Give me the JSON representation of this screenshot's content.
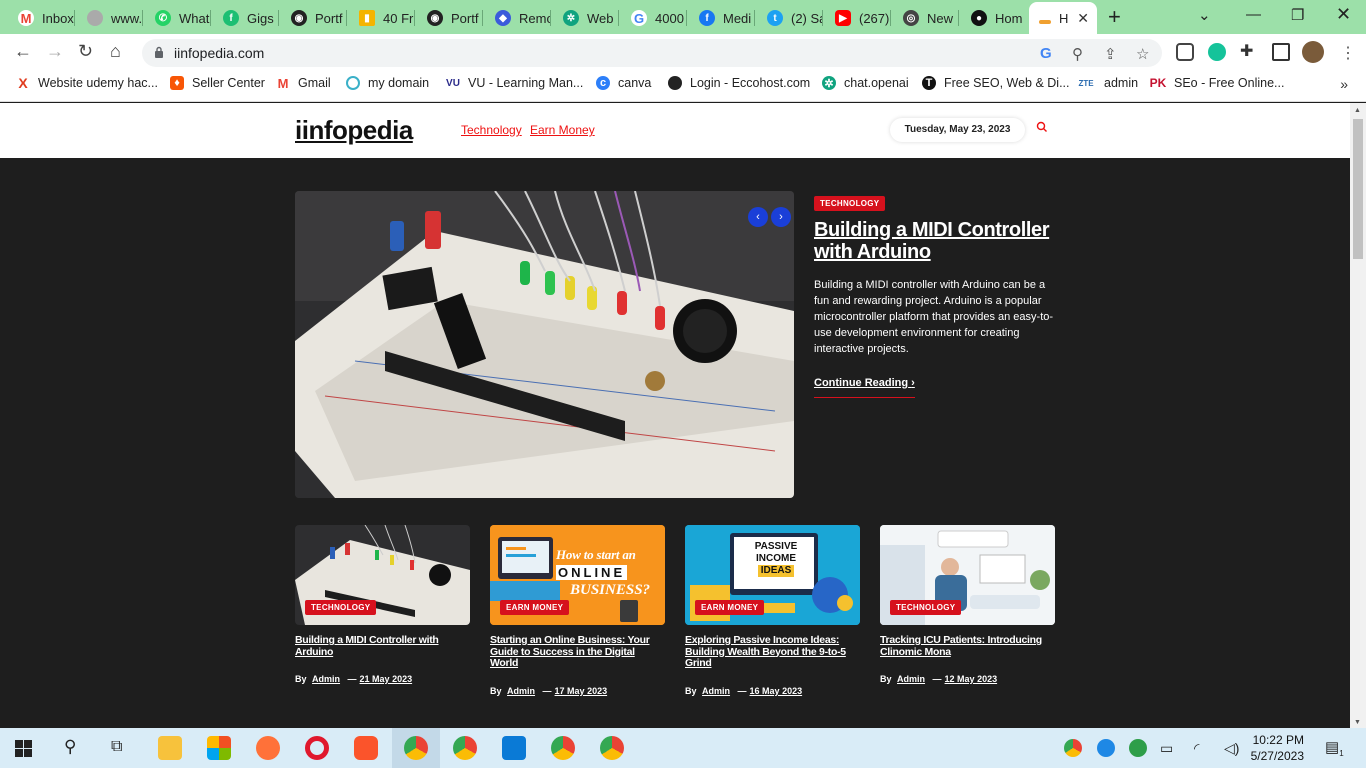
{
  "browser": {
    "tabs": [
      {
        "label": "Inbox",
        "icon": "gmail-icon",
        "color": "#ea4335"
      },
      {
        "label": "www.",
        "icon": "globe-icon",
        "color": "#888888"
      },
      {
        "label": "What",
        "icon": "whatsapp-icon",
        "color": "#25d366"
      },
      {
        "label": "Gigs",
        "icon": "fiverr-icon",
        "color": "#1dbf73"
      },
      {
        "label": "Portf",
        "icon": "site-icon",
        "color": "#222222"
      },
      {
        "label": "40 Fr",
        "icon": "chart-icon",
        "color": "#f4b400"
      },
      {
        "label": "Portf",
        "icon": "site-icon",
        "color": "#222222"
      },
      {
        "label": "Remo",
        "icon": "remote-icon",
        "color": "#3b5bdb"
      },
      {
        "label": "Web",
        "icon": "openai-icon",
        "color": "#10a37f"
      },
      {
        "label": "4000",
        "icon": "google-icon",
        "color": "#4285f4"
      },
      {
        "label": "Medi",
        "icon": "facebook-icon",
        "color": "#1877f2"
      },
      {
        "label": "(2) Sa",
        "icon": "twitter-icon",
        "color": "#1da1f2"
      },
      {
        "label": "(267)",
        "icon": "youtube-icon",
        "color": "#ff0000"
      },
      {
        "label": "New",
        "icon": "chrome-icon",
        "color": "#444444"
      },
      {
        "label": "Hom",
        "icon": "site-icon",
        "color": "#111111"
      },
      {
        "label": "H",
        "icon": "page-icon",
        "color": "#f0a030",
        "active": true
      }
    ],
    "url": "iinfopedia.com",
    "bookmarks": [
      {
        "label": "Website udemy hac...",
        "icon": "x-icon",
        "color": "#e03c1f"
      },
      {
        "label": "Seller Center",
        "icon": "daraz-icon",
        "color": "#f85606"
      },
      {
        "label": "Gmail",
        "icon": "gmail-icon",
        "color": "#ea4335"
      },
      {
        "label": "my domain",
        "icon": "domain-icon",
        "color": "#3ab0c8"
      },
      {
        "label": "VU - Learning Man...",
        "icon": "vu-icon",
        "color": "#2a2a8a"
      },
      {
        "label": "canva",
        "icon": "canva-icon",
        "color": "#2d7ff9"
      },
      {
        "label": "Login - Eccohost.com",
        "icon": "globe-icon",
        "color": "#222222"
      },
      {
        "label": "chat.openai",
        "icon": "openai-icon",
        "color": "#10a37f"
      },
      {
        "label": "Free SEO, Web & Di...",
        "icon": "t-icon",
        "color": "#111111"
      },
      {
        "label": "admin",
        "icon": "zte-icon",
        "color": "#2b6cb0"
      },
      {
        "label": "SEo - Free Online...",
        "icon": "pk-icon",
        "color": "#c41230"
      }
    ]
  },
  "site": {
    "logo": "iinfopedia",
    "nav": [
      "Technology",
      "Earn Money"
    ],
    "date": "Tuesday, May 23, 2023",
    "hero": {
      "badge": "TECHNOLOGY",
      "title": "Building a MIDI Controller with Arduino",
      "excerpt": "Building a MIDI controller with Arduino can be a fun and rewarding project. Arduino is a popular microcontroller platform that provides an easy-to-use development environment for creating interactive projects.",
      "read_more": "Continue Reading"
    },
    "cards": [
      {
        "badge": "TECHNOLOGY",
        "title": "Building a MIDI Controller with Arduino",
        "by": "By",
        "author": "Admin",
        "date": "21 May 2023"
      },
      {
        "badge": "EARN MONEY",
        "title": "Starting an Online Business: Your Guide to Success in the Digital World",
        "by": "By",
        "author": "Admin",
        "date": "17 May 2023",
        "thumb_text": [
          "How to start an",
          "ONLINE",
          "BUSINESS?"
        ]
      },
      {
        "badge": "EARN MONEY",
        "title": "Exploring Passive Income Ideas: Building Wealth Beyond the 9-to-5 Grind",
        "by": "By",
        "author": "Admin",
        "date": "16 May 2023",
        "thumb_text": [
          "PASSIVE",
          "INCOME",
          "IDEAS"
        ]
      },
      {
        "badge": "TECHNOLOGY",
        "title": "Tracking ICU Patients: Introducing Clinomic Mona",
        "by": "By",
        "author": "Admin",
        "date": "12 May 2023"
      }
    ]
  },
  "taskbar": {
    "time": "10:22 PM",
    "date": "5/27/2023",
    "notification_count": "1"
  }
}
